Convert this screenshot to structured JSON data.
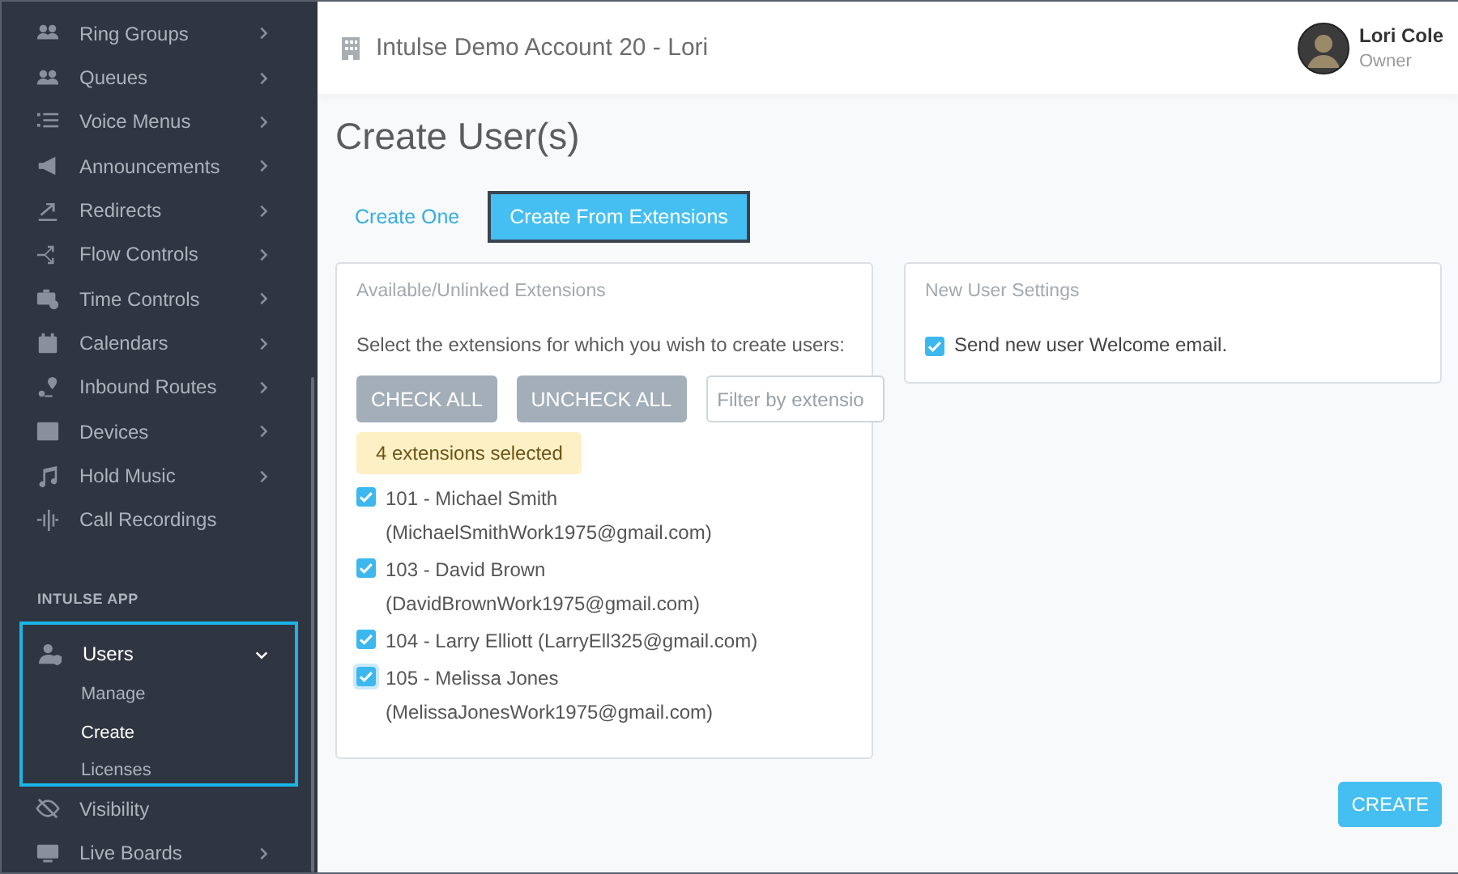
{
  "sidebar": {
    "items": [
      {
        "label": "Ring Groups",
        "submenu": true
      },
      {
        "label": "Queues",
        "submenu": true
      },
      {
        "label": "Voice Menus",
        "submenu": true
      },
      {
        "label": "Announcements",
        "submenu": true
      },
      {
        "label": "Redirects",
        "submenu": true
      },
      {
        "label": "Flow Controls",
        "submenu": true
      },
      {
        "label": "Time Controls",
        "submenu": true
      },
      {
        "label": "Calendars",
        "submenu": true
      },
      {
        "label": "Inbound Routes",
        "submenu": true
      },
      {
        "label": "Devices",
        "submenu": true
      },
      {
        "label": "Hold Music",
        "submenu": true
      },
      {
        "label": "Call Recordings",
        "submenu": false
      }
    ],
    "section_label": "INTULSE APP",
    "app_items": [
      {
        "label": "Users",
        "submenu": true,
        "expanded": true,
        "highlighted": true,
        "children": [
          {
            "label": "Manage",
            "selected": false
          },
          {
            "label": "Create",
            "selected": true
          },
          {
            "label": "Licenses",
            "selected": false
          }
        ]
      },
      {
        "label": "Visibility",
        "submenu": false
      },
      {
        "label": "Live Boards",
        "submenu": true
      }
    ]
  },
  "header": {
    "account": "Intulse Demo Account 20 - Lori",
    "user_name": "Lori Cole",
    "user_role": "Owner"
  },
  "page_title": "Create User(s)",
  "tabs": [
    {
      "label": "Create One",
      "selected": false
    },
    {
      "label": "Create From Extensions",
      "selected": true
    }
  ],
  "extensions_card": {
    "title": "Available/Unlinked Extensions",
    "instruction": "Select the extensions for which you wish to create users:",
    "buttons": [
      "CHECK ALL",
      "UNCHECK ALL"
    ],
    "filter": {
      "placeholder": "Filter by extensio"
    },
    "selected_count": "4 extensions selected",
    "extensions": [
      {
        "label": "101 - Michael Smith (MichaelSmithWork1975@gmail.com)",
        "checked": true,
        "focused": false
      },
      {
        "label": "103 - David Brown (DavidBrownWork1975@gmail.com)",
        "checked": true,
        "focused": false
      },
      {
        "label": "104 - Larry Elliott (LarryEll325@gmail.com)",
        "checked": true,
        "focused": false
      },
      {
        "label": "105 - Melissa Jones (MelissaJonesWork1975@gmail.com)",
        "checked": true,
        "focused": true
      }
    ]
  },
  "settings_card": {
    "title": "New User Settings",
    "options": [
      {
        "label": "Send new user Welcome email.",
        "checked": true
      }
    ]
  },
  "create_button": "CREATE"
}
